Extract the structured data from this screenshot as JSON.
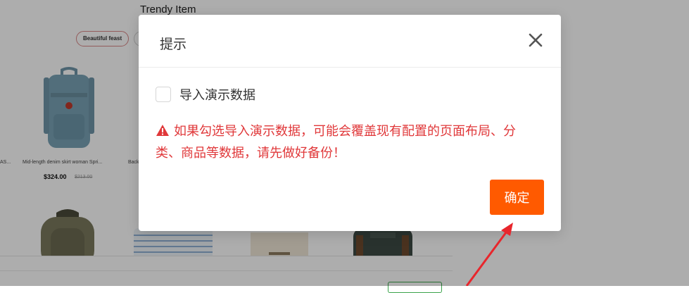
{
  "background": {
    "section_title": "Trendy Item",
    "chip_label": "Beautiful feast",
    "products": [
      {
        "name": "AS..."
      },
      {
        "name": "Mid-length denim skirt woman Spri..."
      },
      {
        "name": "Back"
      }
    ],
    "price": "$324.00",
    "old_price": "$213.00"
  },
  "dialog": {
    "title": "提示",
    "checkbox_label": "导入演示数据",
    "checkbox_checked": false,
    "warning_text": "如果勾选导入演示数据，可能会覆盖现有配置的页面布局、分类、商品等数据，请先做好备份！",
    "confirm_label": "确定"
  },
  "colors": {
    "accent": "#ff5a00",
    "warning": "#e0383a",
    "annotation": "#e8262c"
  }
}
